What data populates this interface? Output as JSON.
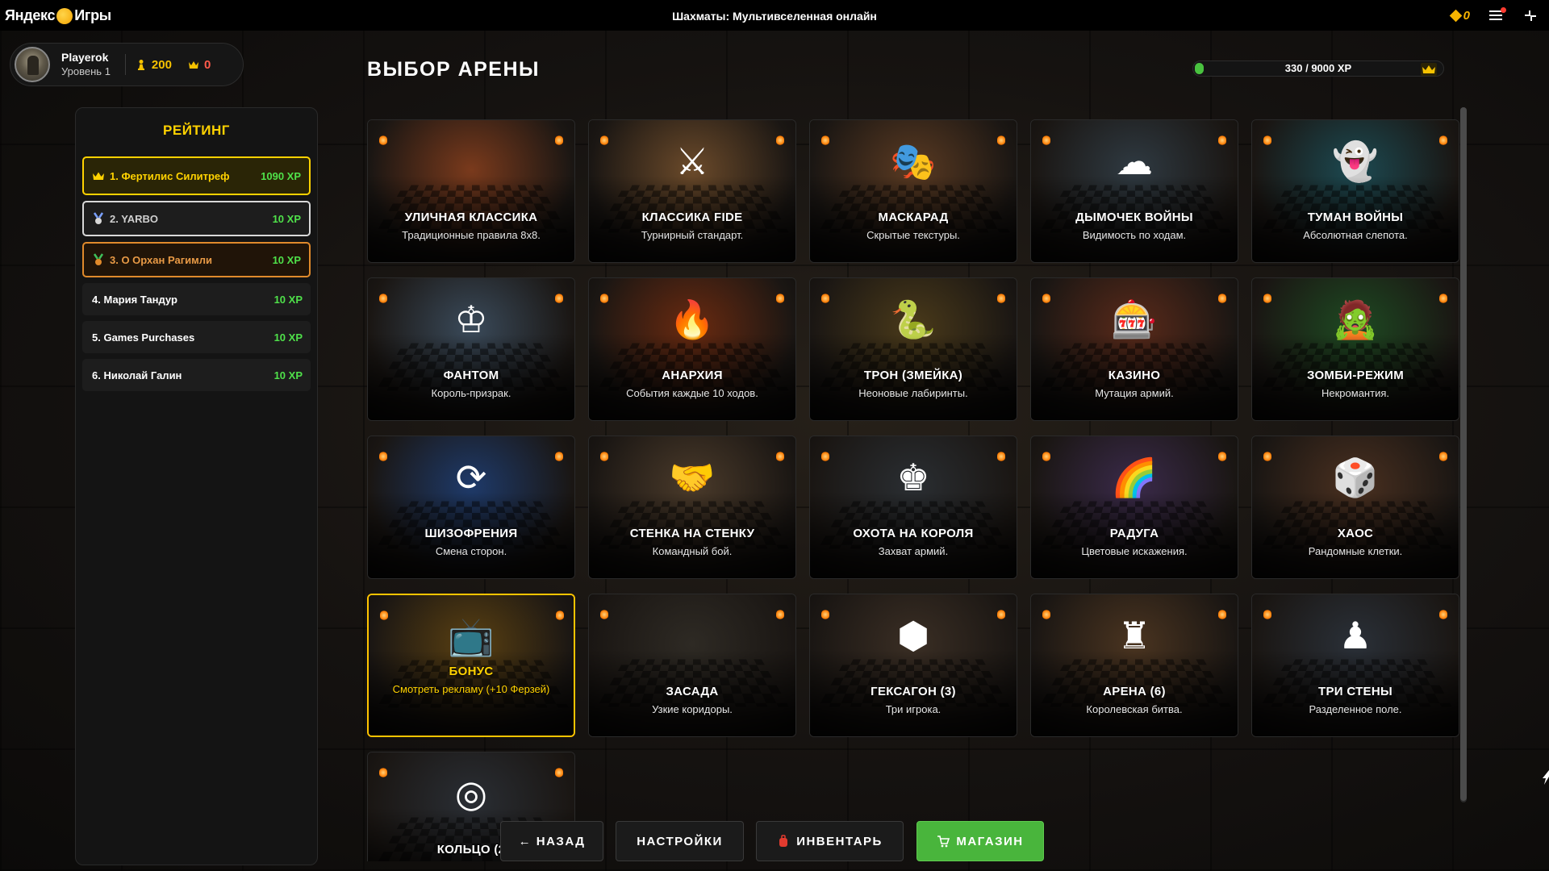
{
  "app": {
    "brand_prefix": "Яндекс",
    "brand_suffix": "Игры",
    "window_title": "Шахматы: Мультивселенная онлайн",
    "yan_balance": "0"
  },
  "player": {
    "name": "Playerok",
    "level": "Уровень 1",
    "pawns": "200",
    "crowns": "0"
  },
  "rating": {
    "title": "РЕЙТИНГ",
    "entries": [
      {
        "name": "1. Фертилис Силитреф",
        "xp": "1090 XP",
        "rank": "gold"
      },
      {
        "name": "2. YARBO",
        "xp": "10 XP",
        "rank": "silver"
      },
      {
        "name": "3. О Орхан Рагимли",
        "xp": "10 XP",
        "rank": "bronze"
      },
      {
        "name": "4. Мария Тандур",
        "xp": "10 XP",
        "rank": "plain"
      },
      {
        "name": "5. Games Purchases",
        "xp": "10 XP",
        "rank": "plain"
      },
      {
        "name": "6. Николай Галин",
        "xp": "10 XP",
        "rank": "plain"
      }
    ]
  },
  "main": {
    "title": "ВЫБОР АРЕНЫ",
    "xp_label": "330 / 9000 XP",
    "xp_progress": 0.0367
  },
  "arenas": [
    {
      "title": "УЛИЧНАЯ КЛАССИКА",
      "desc": "Традиционные правила 8x8.",
      "icon": "street-board",
      "accent": "#7a3a1c"
    },
    {
      "title": "КЛАССИКА FIDE",
      "desc": "Турнирный стандарт.",
      "icon": "crossed-swords",
      "accent": "#6b4a2a"
    },
    {
      "title": "МАСКАРАД",
      "desc": "Скрытые текстуры.",
      "icon": "jester-mask",
      "accent": "#5a3a22"
    },
    {
      "title": "ДЫМОЧЕК ВОЙНЫ",
      "desc": "Видимость по ходам.",
      "icon": "smoke-cloud",
      "accent": "#2f3a42"
    },
    {
      "title": "ТУМАН ВОЙНЫ",
      "desc": "Абсолютная слепота.",
      "icon": "ghost-fog",
      "accent": "#1c4a52"
    },
    {
      "title": "ФАНТОМ",
      "desc": "Король-призрак.",
      "icon": "ghost-king",
      "accent": "#3a4a5a"
    },
    {
      "title": "АНАРХИЯ",
      "desc": "События каждые 10 ходов.",
      "icon": "fire",
      "accent": "#6a2a10"
    },
    {
      "title": "ТРОН (ЗМЕЙКА)",
      "desc": "Неоновые лабиринты.",
      "icon": "snake",
      "accent": "#4a3a1a"
    },
    {
      "title": "КАЗИНО",
      "desc": "Мутация армий.",
      "icon": "slot-machine",
      "accent": "#5a2a1a"
    },
    {
      "title": "ЗОМБИ-РЕЖИМ",
      "desc": "Некромантия.",
      "icon": "zombie",
      "accent": "#1e4a22"
    },
    {
      "title": "ШИЗОФРЕНИЯ",
      "desc": "Смена сторон.",
      "icon": "swap-arrows",
      "accent": "#1e3a6a"
    },
    {
      "title": "СТЕНКА НА СТЕНКУ",
      "desc": "Командный бой.",
      "icon": "handshake",
      "accent": "#4a3a2a"
    },
    {
      "title": "ОХОТА НА КОРОЛЯ",
      "desc": "Захват армий.",
      "icon": "hooded-reaper",
      "accent": "#2a2e32"
    },
    {
      "title": "РАДУГА",
      "desc": "Цветовые искажения.",
      "icon": "rainbow",
      "accent": "#3a2a4a"
    },
    {
      "title": "ХАОС",
      "desc": "Рандомные клетки.",
      "icon": "dice",
      "accent": "#4a3020"
    },
    {
      "title": "БОНУС",
      "desc": "Смотреть рекламу (+10 Ферзей)",
      "icon": "tv",
      "accent": "#5a4012",
      "bonus": true
    },
    {
      "title": "ЗАСАДА",
      "desc": "Узкие коридоры.",
      "icon": "corridor",
      "accent": "#2e2a24"
    },
    {
      "title": "ГЕКСАГОН (3)",
      "desc": "Три игрока.",
      "icon": "hexagon",
      "accent": "#3a2e24"
    },
    {
      "title": "АРЕНА (6)",
      "desc": "Королевская битва.",
      "icon": "arena-six",
      "accent": "#4a3420"
    },
    {
      "title": "ТРИ СТЕНЫ",
      "desc": "Разделенное поле.",
      "icon": "three-walls",
      "accent": "#2a3038"
    },
    {
      "title": "КОЛЬЦО (2",
      "desc": "",
      "icon": "ring-well",
      "accent": "#2a2e34"
    }
  ],
  "buttons": {
    "back": "← НАЗАД",
    "settings": "НАСТРОЙКИ",
    "inventory": "ИНВЕНТАРЬ",
    "shop": "МАГАЗИН"
  },
  "colors": {
    "accent_yellow": "#ffd200",
    "xp_green": "#4fe14a",
    "shop_green": "#49b53c",
    "bronze": "#e08a2b"
  }
}
